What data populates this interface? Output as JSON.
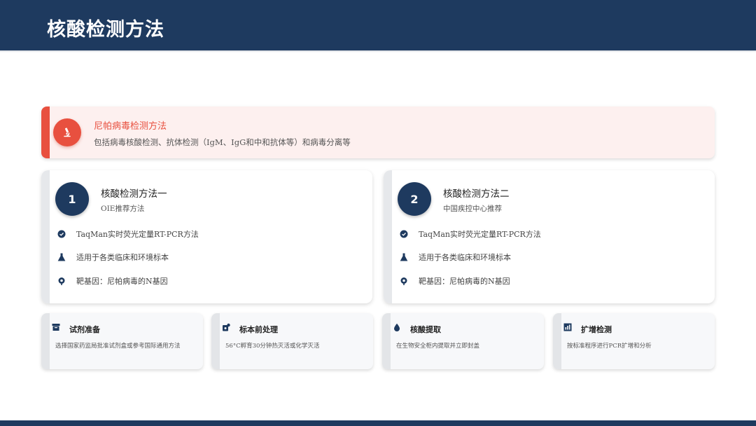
{
  "header": {
    "title": "核酸检测方法"
  },
  "banner": {
    "title": "尼帕病毒检测方法",
    "description": "包括病毒核酸检测、抗体检测（IgM、IgG和中和抗体等）和病毒分离等",
    "icon": "microscope-icon",
    "accent_color": "#e8503f"
  },
  "methods": [
    {
      "number": "1",
      "title": "核酸检测方法一",
      "subtitle": "OIE推荐方法",
      "features": [
        {
          "icon": "check-badge-icon",
          "text": "TaqMan实时荧光定量RT-PCR方法"
        },
        {
          "icon": "flask-icon",
          "text": "适用于各类临床和环境标本"
        },
        {
          "icon": "target-icon",
          "text": "靶基因：尼帕病毒的N基因"
        }
      ]
    },
    {
      "number": "2",
      "title": "核酸检测方法二",
      "subtitle": "中国疾控中心推荐",
      "features": [
        {
          "icon": "check-badge-icon",
          "text": "TaqMan实时荧光定量RT-PCR方法"
        },
        {
          "icon": "flask-icon",
          "text": "适用于各类临床和环境标本"
        },
        {
          "icon": "target-icon",
          "text": "靶基因：尼帕病毒的N基因"
        }
      ]
    }
  ],
  "steps": [
    {
      "icon": "box-icon",
      "title": "试剂准备",
      "description": "选择国家药监局批准试剂盒或参考国际通用方法"
    },
    {
      "icon": "virus-icon",
      "title": "标本前处理",
      "description": "56°C孵育30分钟热灭活或化学灭活"
    },
    {
      "icon": "drop-icon",
      "title": "核酸提取",
      "description": "在生物安全柜内提取并立即封盖"
    },
    {
      "icon": "bar-chart-icon",
      "title": "扩增检测",
      "description": "按标准程序进行PCR扩增和分析"
    }
  ],
  "colors": {
    "primary": "#1e3a5f",
    "accent": "#e8503f"
  }
}
